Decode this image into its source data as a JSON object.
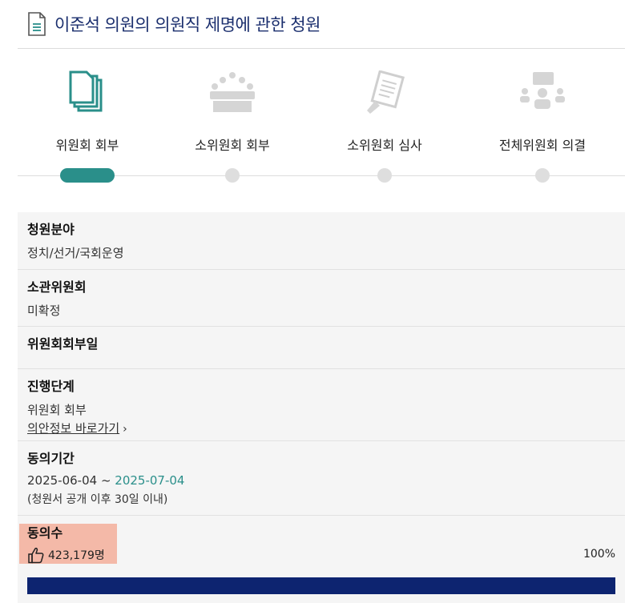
{
  "page": {
    "title": "이준석 의원의 의원직 제명에 관한 청원"
  },
  "steps": [
    {
      "label": "위원회 회부",
      "icon": "documents-icon",
      "active": true
    },
    {
      "label": "소위원회 회부",
      "icon": "committee-meeting-icon",
      "active": false
    },
    {
      "label": "소위원회 심사",
      "icon": "review-document-icon",
      "active": false
    },
    {
      "label": "전체위원회 의결",
      "icon": "plenary-vote-icon",
      "active": false
    }
  ],
  "info": {
    "field": {
      "label": "청원분야",
      "value": "정치/선거/국회운영"
    },
    "committee": {
      "label": "소관위원회",
      "value": "미확정"
    },
    "referral_date": {
      "label": "위원회회부일",
      "value": ""
    },
    "stage": {
      "label": "진행단계",
      "value": "위원회 회부",
      "link": "의안정보 바로가기",
      "link_chevron": "›"
    },
    "period": {
      "label": "동의기간",
      "start": "2025-06-04 ~ ",
      "end": "2025-07-04",
      "note": "(청원서 공개 이후 30일 이내)"
    },
    "agree": {
      "label": "동의수",
      "count": "423,179명",
      "percent_text": "100%",
      "progress": 1.0
    }
  },
  "colors": {
    "accent": "#2a8f8a",
    "title": "#1b2f6e",
    "progress": "#0d2470",
    "highlight": "#f4b9a8"
  }
}
